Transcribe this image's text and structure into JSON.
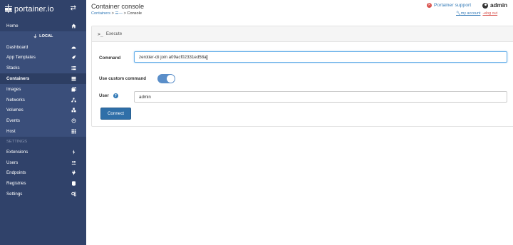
{
  "brand": {
    "name": "portainer.io",
    "toggle_icon": "exchange-icon"
  },
  "sidebar": {
    "home": {
      "label": "Home",
      "icon": "home-icon"
    },
    "endpoint": "LOCAL",
    "items": [
      {
        "label": "Dashboard",
        "icon": "tachometer-icon"
      },
      {
        "label": "App Templates",
        "icon": "rocket-icon"
      },
      {
        "label": "Stacks",
        "icon": "list-icon"
      },
      {
        "label": "Containers",
        "icon": "server-icon",
        "active": true
      },
      {
        "label": "Images",
        "icon": "clone-icon"
      },
      {
        "label": "Networks",
        "icon": "sitemap-icon"
      },
      {
        "label": "Volumes",
        "icon": "cubes-icon"
      },
      {
        "label": "Events",
        "icon": "history-icon"
      },
      {
        "label": "Host",
        "icon": "th-icon"
      }
    ],
    "settings_title": "SETTINGS",
    "settings": [
      {
        "label": "Extensions",
        "icon": "bolt-icon"
      },
      {
        "label": "Users",
        "icon": "users-icon"
      },
      {
        "label": "Endpoints",
        "icon": "plug-icon"
      },
      {
        "label": "Registries",
        "icon": "database-icon"
      },
      {
        "label": "Settings",
        "icon": "cogs-icon"
      }
    ]
  },
  "header": {
    "title": "Container console",
    "breadcrumb": {
      "root": "Containers",
      "sep1": " > ",
      "container": "☰—",
      "sep2": " > ",
      "current": "Console"
    },
    "support": "Portainer support",
    "username": "admin",
    "my_account": "my account",
    "log_out": "log out"
  },
  "panel": {
    "title": "Execute",
    "command_label": "Command",
    "command_value": "zerotier-cli join a09acf02331ed58a",
    "custom_command_label": "Use custom command",
    "custom_command_on": true,
    "user_label": "User",
    "user_value": "admin",
    "connect_label": "Connect"
  },
  "colors": {
    "sidebar": "#30426a",
    "primary": "#2f6fa8",
    "toggle": "#5a8ec9",
    "danger": "#d9534f"
  }
}
